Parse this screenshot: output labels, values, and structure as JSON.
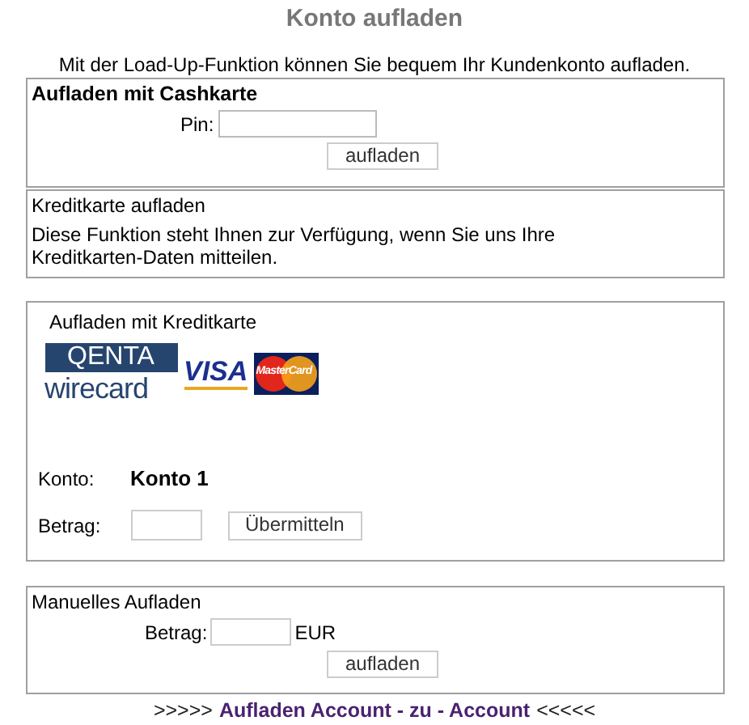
{
  "title": "Konto aufladen",
  "intro": "Mit der Load-Up-Funktion können Sie bequem Ihr Kundenkonto aufladen.",
  "cashcard": {
    "heading": "Aufladen mit Cashkarte",
    "pin_label": "Pin:",
    "button": "aufladen"
  },
  "creditcard_info": {
    "heading": "Kreditkarte aufladen",
    "text": "Diese Funktion steht Ihnen zur Verfügung, wenn Sie uns Ihre Kreditkarten-Daten mitteilen."
  },
  "creditcard": {
    "heading": "Aufladen mit Kreditkarte",
    "logos": {
      "qenta": "QENTA",
      "wirecard": "wirecard",
      "visa": "VISA",
      "mastercard": "MasterCard"
    },
    "account_label": "Konto:",
    "account_value": "Konto 1",
    "amount_label": "Betrag:",
    "button": "Übermitteln"
  },
  "manual": {
    "heading": "Manuelles Aufladen",
    "amount_label": "Betrag:",
    "currency": "EUR",
    "button": "aufladen"
  },
  "footer": {
    "prefix": ">>>>>",
    "link": "Aufladen Account - zu - Account",
    "suffix": "<<<<<"
  }
}
